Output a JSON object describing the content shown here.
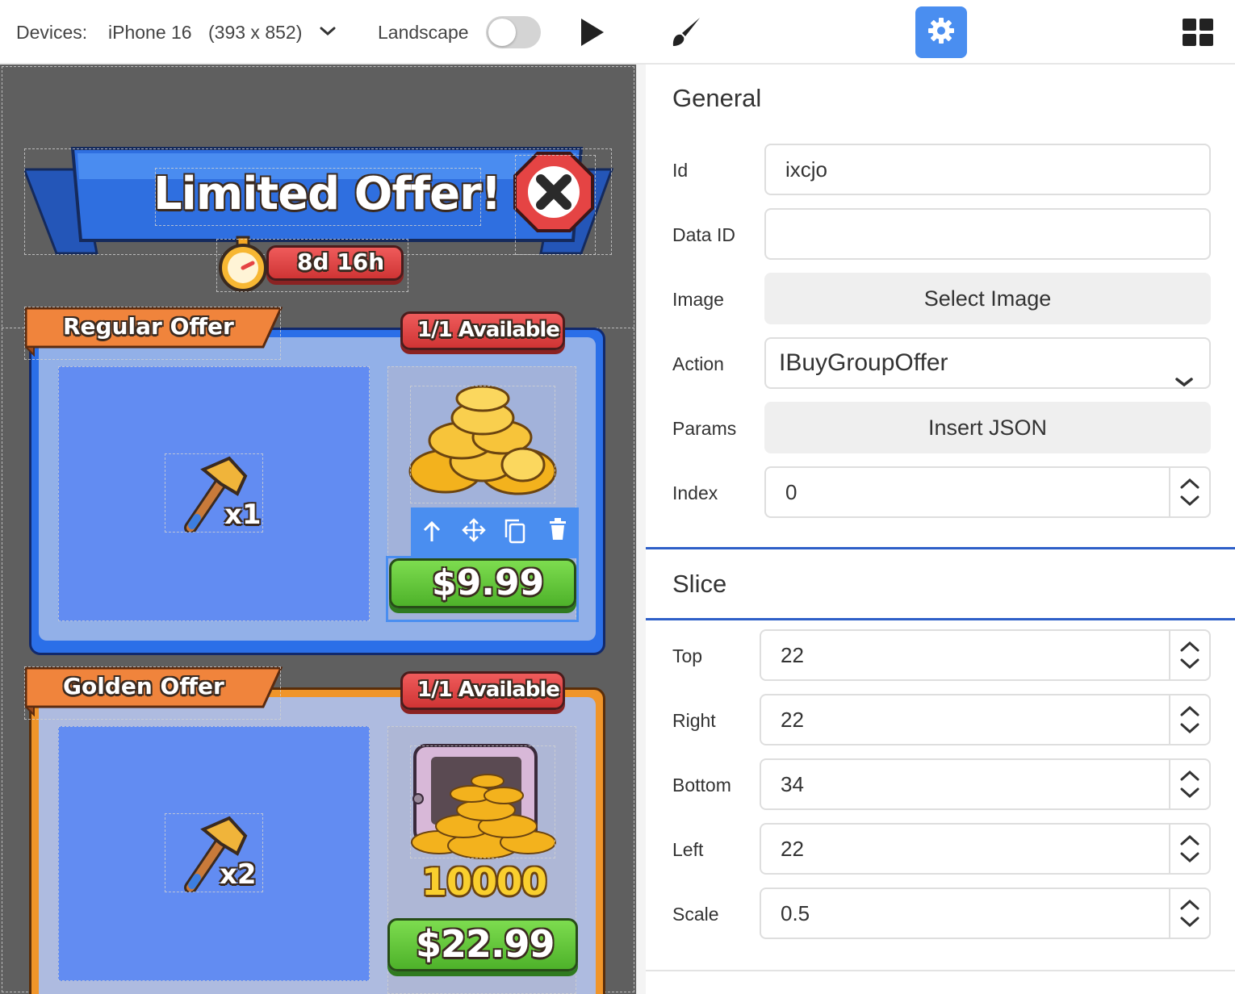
{
  "topbar": {
    "devices_label": "Devices:",
    "device_name": "iPhone 16",
    "device_size": "(393 x 852)",
    "landscape_label": "Landscape",
    "landscape_on": false,
    "icons": [
      "chevron-down-icon",
      "play-icon",
      "brush-icon",
      "gear-icon",
      "grid-icon"
    ]
  },
  "canvas": {
    "title": "Limited Offer!",
    "timer": "8d 16h",
    "offers": [
      {
        "ribbon": "Regular Offer",
        "availability": "1/1 Available",
        "item_qty": "x1",
        "price": "$9.99",
        "color": "#2b6fe8"
      },
      {
        "ribbon": "Golden Offer",
        "availability": "1/1 Available",
        "item_qty": "x2",
        "coins": "10000",
        "price": "$22.99",
        "color": "#f0952a"
      }
    ],
    "toolbar_icons": [
      "arrow-up-icon",
      "move-icon",
      "copy-icon",
      "trash-icon"
    ]
  },
  "panel": {
    "general": {
      "title": "General",
      "id_label": "Id",
      "id_value": "ixcjo",
      "dataid_label": "Data ID",
      "dataid_value": "",
      "image_label": "Image",
      "image_button": "Select Image",
      "action_label": "Action",
      "action_value": "IBuyGroupOffer",
      "params_label": "Params",
      "params_button": "Insert JSON",
      "index_label": "Index",
      "index_value": "0"
    },
    "slice": {
      "title": "Slice",
      "top_label": "Top",
      "top_value": "22",
      "right_label": "Right",
      "right_value": "22",
      "bottom_label": "Bottom",
      "bottom_value": "34",
      "left_label": "Left",
      "left_value": "22",
      "scale_label": "Scale",
      "scale_value": "0.5"
    },
    "accent": "#2e5fc8"
  }
}
